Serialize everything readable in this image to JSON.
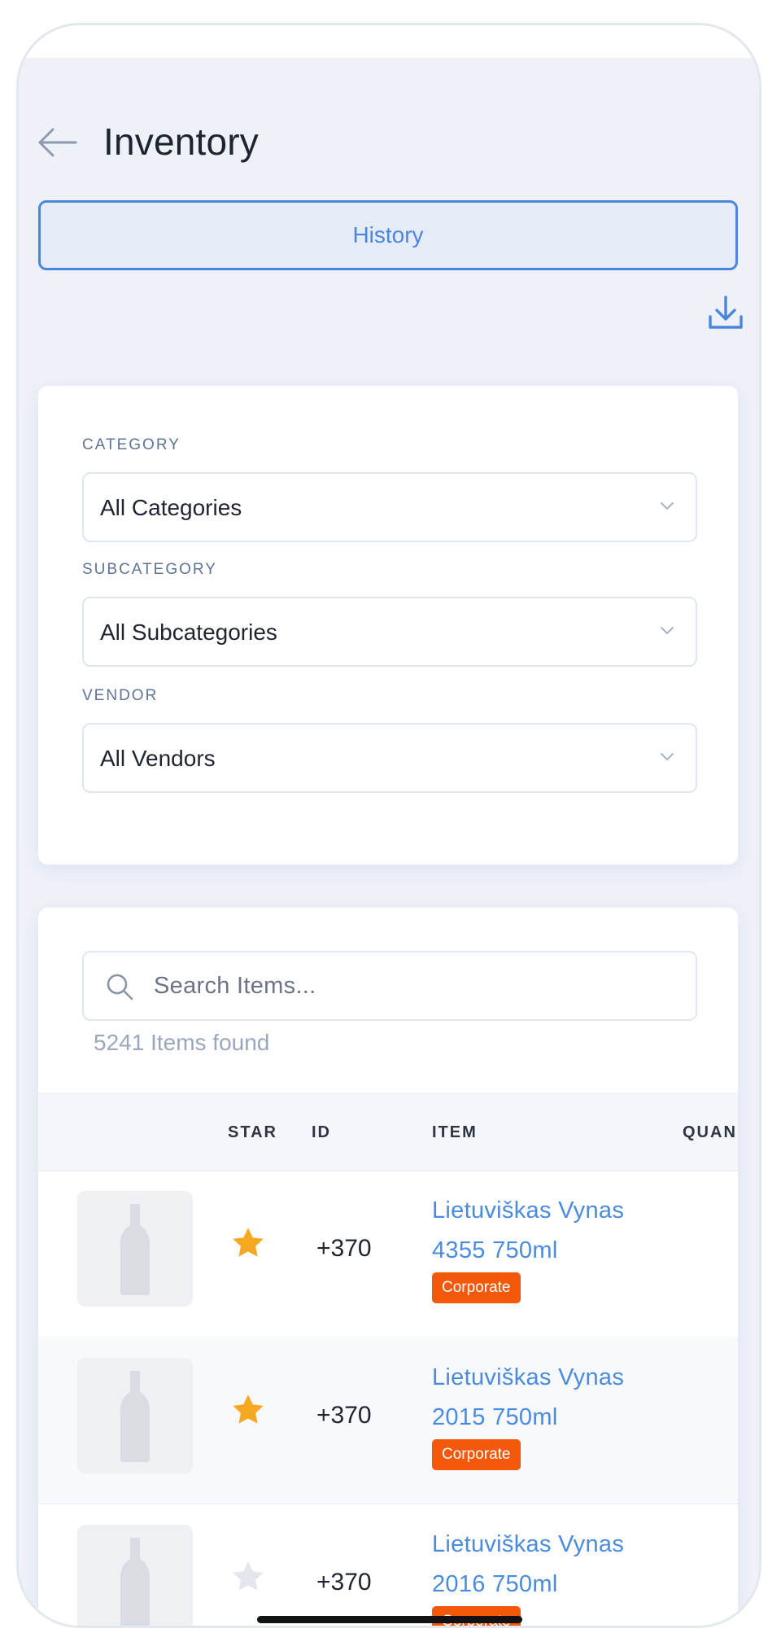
{
  "header": {
    "title": "Inventory"
  },
  "history_button": {
    "label": "History"
  },
  "filters": [
    {
      "label": "CATEGORY",
      "value": "All Categories"
    },
    {
      "label": "SUBCATEGORY",
      "value": "All Subcategories"
    },
    {
      "label": "VENDOR",
      "value": "All Vendors"
    }
  ],
  "search": {
    "placeholder": "Search Items...",
    "count_text": "5241 Items found"
  },
  "table": {
    "columns": [
      "STAR",
      "ID",
      "ITEM",
      "QUAN"
    ],
    "rows": [
      {
        "starred": true,
        "id": "+370",
        "item": "Lietuviškas Vynas 4355 750ml",
        "tag": "Corporate"
      },
      {
        "starred": true,
        "id": "+370",
        "item": "Lietuviškas Vynas 2015 750ml",
        "tag": "Corporate"
      },
      {
        "starred": false,
        "id": "+370",
        "item": "Lietuviškas Vynas 2016 750ml",
        "tag": "Corporate"
      }
    ]
  },
  "colors": {
    "accent": "#4a86db",
    "star_active": "#f7a823",
    "star_inactive": "#e3e6ec",
    "tag": "#f4580a",
    "screen_bg": "#eef1f8"
  },
  "icons": [
    "back-arrow-icon",
    "download-icon",
    "chevron-down-icon",
    "search-icon",
    "star-icon",
    "bottle-icon"
  ]
}
